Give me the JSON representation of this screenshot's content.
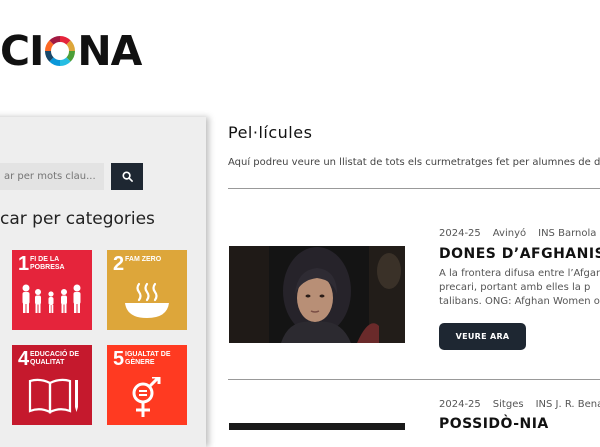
{
  "site": {
    "logo_text_left": "CI",
    "logo_text_right": "NA"
  },
  "sidebar": {
    "search_placeholder": "ar per mots clau...",
    "categories_title": "car per categories",
    "tiles": [
      {
        "number": "1",
        "label": "Fi de la pobresa",
        "color": "#e5243b"
      },
      {
        "number": "2",
        "label": "Fam zero",
        "color": "#dda63a"
      },
      {
        "number": "4",
        "label": "Educació de qualitat",
        "color": "#c5192d"
      },
      {
        "number": "5",
        "label": "Igualtat de gènere",
        "color": "#ff3a21"
      }
    ]
  },
  "main": {
    "title": "Pel·lícules",
    "intro": "Aquí podreu veure un llistat de tots els curmetratges fet per alumnes de d",
    "films": [
      {
        "year": "2024-25",
        "town": "Avinyó",
        "school": "INS Barnola",
        "title": "DONES D’AFGHANISTA",
        "desc_lines": [
          "A la frontera difusa entre l’Afgan",
          "precari, portant amb elles la p",
          "talibans. ONG: Afghan Women o"
        ],
        "button": "VEURE ARA"
      },
      {
        "year": "2024-25",
        "town": "Sitges",
        "school": "INS J. R. Benap",
        "title": "POSSIDÒ-NIA"
      }
    ]
  },
  "colors": {
    "dark_button": "#1e2732",
    "sidebar_bg": "#eeeeee"
  }
}
